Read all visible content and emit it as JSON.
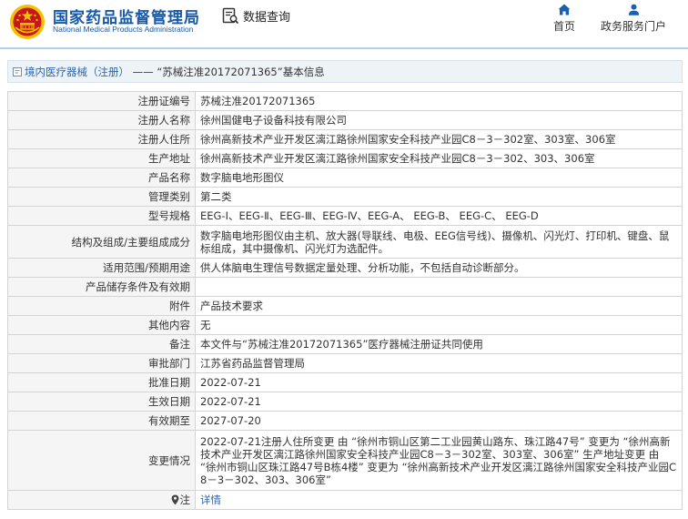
{
  "header": {
    "brand_cn": "国家药品监督管理局",
    "brand_en": "National Medical Products Administration",
    "module_label": "数据查询",
    "nav": [
      {
        "label": "首页",
        "icon": "home-icon"
      },
      {
        "label": "政务服务门户",
        "icon": "user-icon"
      }
    ]
  },
  "titlebar": {
    "category": "境内医疗器械（注册）",
    "separator": "——",
    "subject": "“苏械注准20172071365”基本信息"
  },
  "rows": [
    {
      "label": "注册证编号",
      "value": "苏械注准20172071365"
    },
    {
      "label": "注册人名称",
      "value": "徐州国健电子设备科技有限公司"
    },
    {
      "label": "注册人住所",
      "value": "徐州高新技术产业开发区漓江路徐州国家安全科技产业园C8－3－302室、303室、306室"
    },
    {
      "label": "生产地址",
      "value": "徐州高新技术产业开发区漓江路徐州国家安全科技产业园C8－3－302、303、306室"
    },
    {
      "label": "产品名称",
      "value": "数字脑电地形图仪"
    },
    {
      "label": "管理类别",
      "value": "第二类"
    },
    {
      "label": "型号规格",
      "value": "EEG-Ⅰ、EEG-Ⅱ、EEG-Ⅲ、EEG-Ⅳ、EEG-A、 EEG-B、 EEG-C、 EEG-D"
    },
    {
      "label": "结构及组成/主要组成成分",
      "value": "数字脑电地形图仪由主机、放大器(导联线、电极、EEG信号线)、摄像机、闪光灯、打印机、键盘、鼠标组成，其中摄像机、闪光灯为选配件。"
    },
    {
      "label": "适用范围/预期用途",
      "value": "供人体脑电生理信号数据定量处理、分析功能，不包括自动诊断部分。"
    },
    {
      "label": "产品储存条件及有效期",
      "value": ""
    },
    {
      "label": "附件",
      "value": "产品技术要求"
    },
    {
      "label": "其他内容",
      "value": "无"
    },
    {
      "label": "备注",
      "value": "本文件与“苏械注准20172071365”医疗器械注册证共同使用"
    },
    {
      "label": "审批部门",
      "value": "江苏省药品监督管理局"
    },
    {
      "label": "批准日期",
      "value": "2022-07-21"
    },
    {
      "label": "生效日期",
      "value": "2022-07-21"
    },
    {
      "label": "有效期至",
      "value": "2027-07-20"
    },
    {
      "label": "变更情况",
      "value": "2022-07-21注册人住所变更 由 “徐州市铜山区第二工业园黄山路东、珠江路47号” 变更为 “徐州高新技术产业开发区漓江路徐州国家安全科技产业园C8－3－302室、303室、306室” 生产地址变更 由 “徐州市铜山区珠江路47号B栋4楼” 变更为 “徐州高新技术产业开发区漓江路徐州国家安全科技产业园C8－3－302、303、306室”"
    },
    {
      "label": "注",
      "value": "详情"
    }
  ],
  "colors": {
    "brand_blue": "#1559a7",
    "link_blue": "#2c66b0",
    "emblem_red": "#c8161d",
    "emblem_gold": "#f2c200"
  }
}
